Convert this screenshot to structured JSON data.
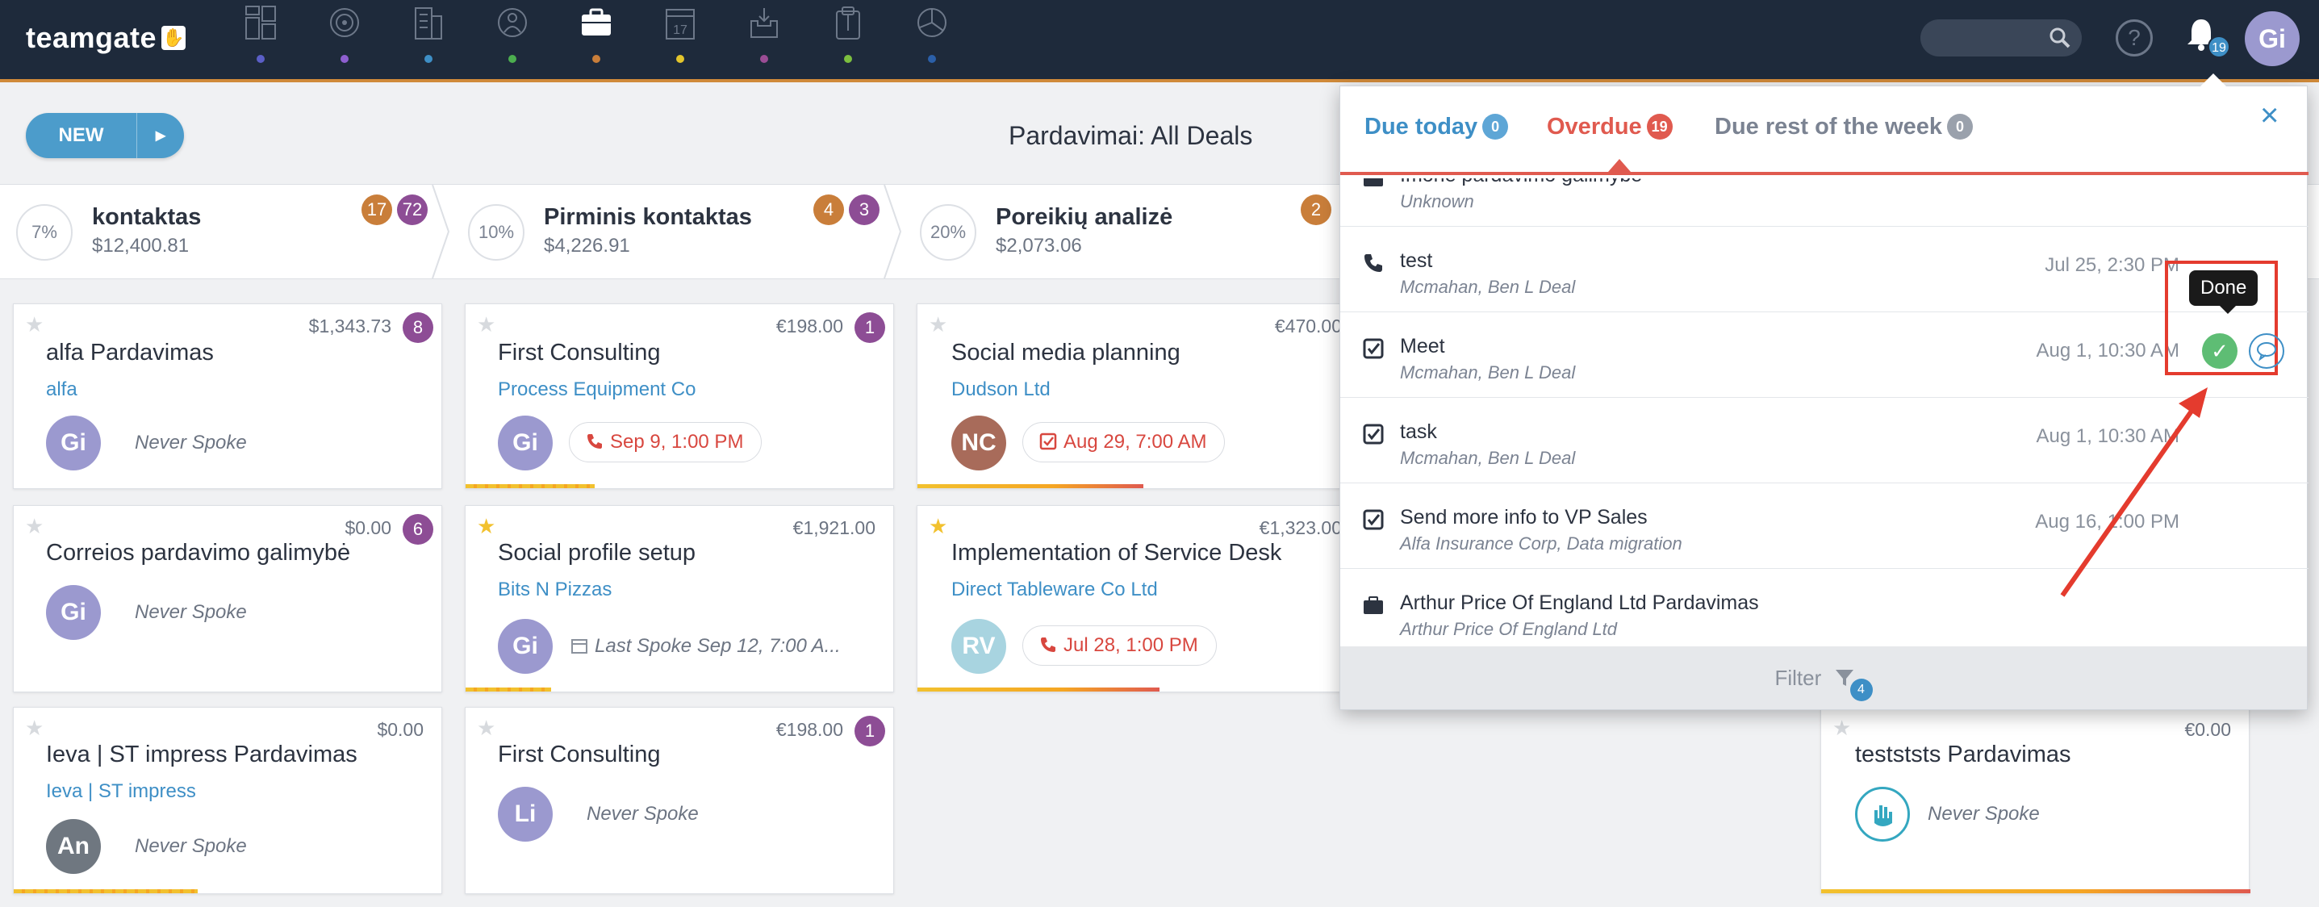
{
  "app": {
    "logo_text": "teamgate",
    "notifications_count": "19",
    "user_initials": "Gi",
    "help_glyph": "?"
  },
  "nav_icons": [
    {
      "name": "dashboard-icon",
      "dot": "#5b5fc7"
    },
    {
      "name": "target-icon",
      "dot": "#8e5fd0"
    },
    {
      "name": "companies-icon",
      "dot": "#3e8fc6"
    },
    {
      "name": "people-icon",
      "dot": "#4cae4f"
    },
    {
      "name": "deals-icon",
      "dot": "#c97e3a"
    },
    {
      "name": "calendar-icon",
      "dot": "#e3c52c",
      "label": "17"
    },
    {
      "name": "inbox-icon",
      "dot": "#9b4d95"
    },
    {
      "name": "clipboard-icon",
      "dot": "#7cbf3f"
    },
    {
      "name": "reports-icon",
      "dot": "#2b5fa8"
    }
  ],
  "toolbar": {
    "new_label": "NEW",
    "page_title": "Pardavimai: All Deals"
  },
  "stages": [
    {
      "pct": "7%",
      "name": "kontaktas",
      "amount": "$12,400.81",
      "badge1": "17",
      "badge2": "72"
    },
    {
      "pct": "10%",
      "name": "Pirminis kontaktas",
      "amount": "$4,226.91",
      "badge1": "4",
      "badge2": "3"
    },
    {
      "pct": "20%",
      "name": "Poreikių analizė",
      "amount": "$2,073.06",
      "badge1": "2"
    }
  ],
  "cards": [
    {
      "title": "alfa Pardavimas",
      "price": "$1,343.73",
      "badge": "8",
      "company": "alfa",
      "avatar": "Gi",
      "spoke": "Never Spoke"
    },
    {
      "title": "Correios pardavimo galimybė",
      "price": "$0.00",
      "badge": "6",
      "avatar": "Gi",
      "spoke": "Never Spoke"
    },
    {
      "title": "Ieva | ST impress Pardavimas",
      "price": "$0.00",
      "company": "Ieva | ST impress",
      "avatar": "An",
      "spoke": "Never Spoke"
    },
    {
      "title": "First Consulting",
      "price": "€198.00",
      "badge": "1",
      "company": "Process Equipment Co",
      "avatar": "Gi",
      "due": "Sep 9, 1:00 PM"
    },
    {
      "title": "Social profile setup",
      "price": "€1,921.00",
      "company": "Bits N Pizzas",
      "avatar": "Gi",
      "spoke": "Last Spoke Sep 12, 7:00 A..."
    },
    {
      "title": "First Consulting",
      "price": "€198.00",
      "badge": "1",
      "avatar": "Li",
      "spoke": "Never Spoke"
    },
    {
      "title": "Social media planning",
      "price": "€470.00",
      "company": "Dudson Ltd",
      "avatar": "NC",
      "due": "Aug 29, 7:00 AM"
    },
    {
      "title": "Implementation of Service Desk",
      "price": "€1,323.00",
      "company": "Direct Tableware Co Ltd",
      "avatar": "RV",
      "due": "Jul 28, 1:00 PM"
    },
    {
      "title": "testststs Pardavimas",
      "price": "€0.00",
      "spoke": "Never Spoke"
    }
  ],
  "panel": {
    "tabs": [
      {
        "label": "Due today",
        "count": "0"
      },
      {
        "label": "Overdue",
        "count": "19"
      },
      {
        "label": "Due rest of the week",
        "count": "0"
      }
    ],
    "close_glyph": "×",
    "tasks": [
      {
        "icon": "briefcase-icon",
        "title": "Imone pardavimo galimybe",
        "sub": "Unknown",
        "date": ""
      },
      {
        "icon": "phone-icon",
        "title": "test",
        "sub": "Mcmahan, Ben L Deal",
        "date": "Jul 25, 2:30 PM"
      },
      {
        "icon": "task-check-icon",
        "title": "Meet",
        "sub": "Mcmahan, Ben L Deal",
        "date": "Aug 1, 10:30 AM"
      },
      {
        "icon": "task-check-icon",
        "title": "task",
        "sub": "Mcmahan, Ben L Deal",
        "date": "Aug 1, 10:30 AM"
      },
      {
        "icon": "task-check-icon",
        "title": "Send more info to VP Sales",
        "sub": "Alfa Insurance Corp, Data migration",
        "date": "Aug 16, 1:00 PM"
      },
      {
        "icon": "briefcase-icon",
        "title": "Arthur Price Of England Ltd Pardavimas",
        "sub": "Arthur Price Of England Ltd",
        "date": ""
      }
    ],
    "tooltip": "Done",
    "done_glyph": "✓",
    "filter_label": "Filter",
    "filter_count": "4"
  },
  "colors": {
    "topbar": "#1e2a3b",
    "accent": "#3e8fc6",
    "overdue": "#e05a4f",
    "annotation": "#e43b2e"
  }
}
